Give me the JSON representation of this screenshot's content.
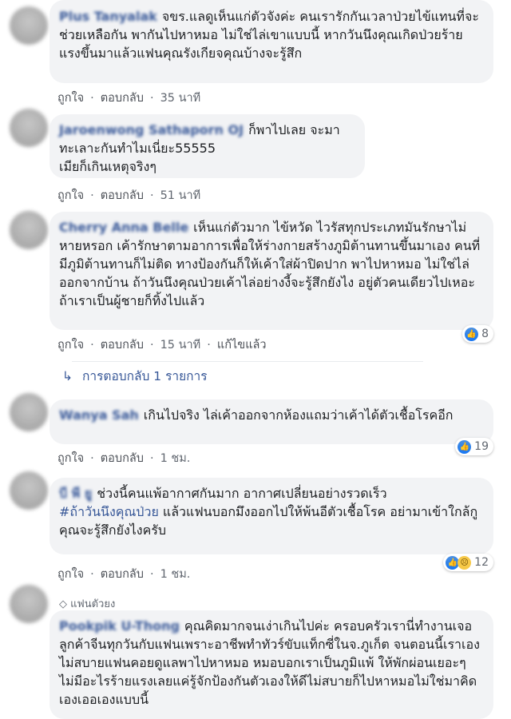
{
  "comments": [
    {
      "author": "Plus Tanyalak",
      "text": "จขร.แลดูเห็นแก่ตัวจังค่ะ คนเรารักกันเวลาป่วยไข้แทนที่จะช่วยเหลือกัน พากันไปหาหมอ ไม่ใช่ไล่เขาแบบนี้ หากวันนึงคุณเกิดป่วยร้ายแรงขึ้นมาแล้วแฟนคุณรังเกียจคุณบ้างจะรู้สึก",
      "like": "ถูกใจ",
      "reply": "ตอบกลับ",
      "time": "35 นาที"
    },
    {
      "author": "Jaroenwong Sathaporn OJ",
      "text": "ก็พาไปเลย จะมาทะเลาะกันทำไมเนี่ยะ55555",
      "text2": "เมียก็เกินเหตุจริงๆ",
      "like": "ถูกใจ",
      "reply": "ตอบกลับ",
      "time": "51 นาที"
    },
    {
      "author": "Cherry Anna Belle",
      "text": "เห็นแก่ตัวมาก ไข้หวัด ไวรัสทุกประเภทมันรักษาไม่หายหรอก เค้ารักษาตามอาการเพื่อให้ร่างกายสร้างภูมิต้านทานขึ้นมาเอง คนที่มีภูมิต้านทานก็ไม่ติด ทางป้องกันก็ให้เค้าใส่ผ้าปิดปาก พาไปหาหมอ ไม่ใช่ไล่ออกจากบ้าน ถ้าวันนึงคุณป่วยเค้าไล่อย่างงี้จะรู้สึกยังไง อยู่ตัวคนเดียวไปเหอะ ถ้าเราเป็นผู้ชายก็ทิ้งไปแล้ว",
      "like": "ถูกใจ",
      "reply": "ตอบกลับ",
      "time": "15 นาที",
      "edited": "แก้ไขแล้ว",
      "reaction_count": "8",
      "replies_label": "การตอบกลับ 1 รายการ"
    },
    {
      "author": "Wanya Sah",
      "text": "เกินไปจริง ไล่เค้าออกจากห้องแถมว่าเค้าได้ตัวเชื้อโรคอีก",
      "like": "ถูกใจ",
      "reply": "ตอบกลับ",
      "time": "1 ชม.",
      "reaction_count": "19"
    },
    {
      "author": "บี พี ยู",
      "text": "ช่วงนี้คนแพ้อากาศกันมาก อากาศเปลี่ยนอย่างรวดเร็ว",
      "hashtag": "#ถ้าวันนึงคุณป่วย",
      "text_after_hashtag": "แล้วแฟนบอกมึงออกไปให้พ้นอีตัวเชื้อโรค อย่ามาเข้าใกล้กู",
      "text2": "คุณจะรู้สึกยังไงครับ",
      "like": "ถูกใจ",
      "reply": "ตอบกลับ",
      "time": "1 ชม.",
      "reaction_count": "12"
    },
    {
      "badge": "แฟนตัวยง",
      "author": "Pookpik U-Thong",
      "text": "คุณคิดมากจนเง่าเกินไปค่ะ ครอบครัวเรานี่ทำงานเจอลูกค้าจีนทุกวันกับแฟนเพราะอาชีพทำทัวร์ขับแท็กซี่ในจ.ภูเก็ต จนตอนนี้เราเองไม่สบายแฟนคอยดูแลพาไปหาหมอ หมอบอกเราเป็นภูมิแพ้ ให้พักผ่อนเยอะๆ ไม่มีอะไรร้ายแรงเลยแค่รู้จักป้องกันตัวเองให้ดีไม่สบายก็ไปหาหมอไม่ใช่มาคิดเองเออเองแบบนี้"
    }
  ],
  "separator": "·",
  "colors": {
    "link": "#385898",
    "bubble": "#f2f3f5",
    "like": "#1877f2"
  },
  "icons": [
    "avatar",
    "like-icon",
    "sad-icon",
    "reply-arrow-icon",
    "diamond-icon"
  ]
}
